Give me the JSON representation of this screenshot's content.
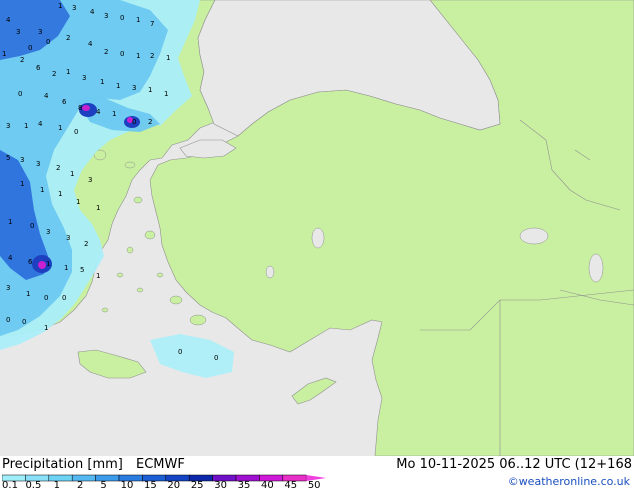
{
  "header": {
    "title": "Precipitation [mm]",
    "model": "ECMWF",
    "datetime": "Mo 10-11-2025 06..12 UTC (12+168"
  },
  "credit": "©weatheronline.co.uk",
  "legend": {
    "ticks": [
      "0.1",
      "0.5",
      "1",
      "2",
      "5",
      "10",
      "15",
      "20",
      "25",
      "30",
      "35",
      "40",
      "45",
      "50"
    ],
    "colors": [
      "#a0eefa",
      "#8ae0f8",
      "#6ed2f4",
      "#55b8f0",
      "#3c9cea",
      "#2a7ce0",
      "#1c5ed4",
      "#1444c4",
      "#0c28a8",
      "#7010c8",
      "#a010d0",
      "#d018d8",
      "#e830c8"
    ],
    "arrow_color": "#f040e0"
  },
  "map_colors": {
    "sea": "#e8e8e8",
    "land": "#c8f0a0",
    "border": "#909090",
    "light_rain": "#aaeefa",
    "moderate_rain": "#6cc8f0",
    "heavy_rain": "#2c70dc",
    "intense_rain": "#c820d0"
  },
  "map_labels": {
    "values": [
      "4",
      "3",
      "1",
      "3",
      "4",
      "3",
      "0",
      "1",
      "7",
      "3",
      "0",
      "0",
      "2",
      "4",
      "2",
      "0",
      "1",
      "2",
      "1",
      "1",
      "2",
      "6",
      "2",
      "1",
      "3",
      "1",
      "1",
      "3",
      "1",
      "1",
      "0",
      "4",
      "6",
      "8",
      "4",
      "1",
      "0",
      "2",
      "3",
      "1",
      "4",
      "1",
      "0",
      "5",
      "3",
      "3",
      "2",
      "1",
      "3",
      "1",
      "1",
      "1",
      "1",
      "1",
      "1",
      "0",
      "3",
      "3",
      "2",
      "4",
      "6",
      "1",
      "1",
      "5",
      "1",
      "3",
      "1",
      "0",
      "0",
      "0",
      "0",
      "1",
      "0",
      "0",
      "0"
    ]
  }
}
